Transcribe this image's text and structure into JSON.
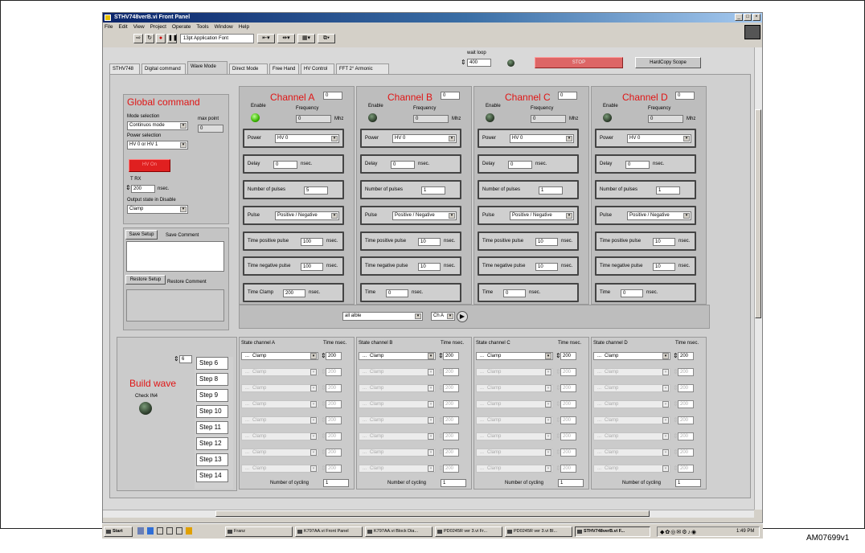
{
  "window": {
    "title": "STHV748verB.vi Front Panel"
  },
  "menu": [
    "File",
    "Edit",
    "View",
    "Project",
    "Operate",
    "Tools",
    "Window",
    "Help"
  ],
  "toolbar": {
    "font": "13pt Application Font"
  },
  "wait_loop": {
    "label": "wait loop",
    "value": "400"
  },
  "buttons": {
    "stop": "STOP",
    "hardcopy": "HardCopy Scope",
    "save_setup": "Save Setup",
    "restore_setup": "Restore Setup",
    "hv_on": "HV On"
  },
  "tabs": [
    "STHV748",
    "Digital command",
    "Wave Mode",
    "Direct Mode",
    "Free Hand",
    "HV Control",
    "FFT 2° Armonic"
  ],
  "global": {
    "title": "Global command",
    "mode_label": "Mode selection",
    "mode_value": "Continuos mode",
    "max_point_label": "max point",
    "max_point_value": "0",
    "power_label": "Power selection",
    "power_value": "HV 0 or HV 1",
    "trx_label": "T RX",
    "trx_value": "200",
    "nsec": "nsec.",
    "out_label": "Output state in Disable",
    "out_value": "Clamp",
    "save_comment": "Save Comment",
    "restore_comment": "Restore Comment"
  },
  "channels": [
    {
      "title": "Channel A",
      "id": "0",
      "enable_label": "Enable",
      "freq_label": "Frequency",
      "freq_value": "0",
      "freq_unit": "Mhz",
      "power_label": "Power",
      "power": "HV 0",
      "delay_label": "Delay",
      "delay": "0",
      "pulses_label": "Number of pulses",
      "pulses": "5",
      "pulse_label": "Pulse",
      "pulse": "Positive / Negative",
      "tpos_label": "Time positive pulse",
      "tpos": "100",
      "tneg_label": "Time negative pulse",
      "tneg": "100",
      "time_label": "Time Clamp",
      "time": "200",
      "unit": "nsec.",
      "led": "on",
      "state_label": "State channel A",
      "time_nsec_label": "Time nsec.",
      "cycling_label": "Number of cycling",
      "cycling": "1"
    },
    {
      "title": "Channel B",
      "id": "0",
      "enable_label": "Enable",
      "freq_label": "Frequency",
      "freq_value": "0",
      "freq_unit": "Mhz",
      "power_label": "Power",
      "power": "HV 0",
      "delay_label": "Delay",
      "delay": "0",
      "pulses_label": "Number of pulses",
      "pulses": "1",
      "pulse_label": "Pulse",
      "pulse": "Positive / Negative",
      "tpos_label": "Time positive pulse",
      "tpos": "10",
      "tneg_label": "Time negative pulse",
      "tneg": "10",
      "time_label": "Time",
      "time": "0",
      "unit": "nsec.",
      "led": "off",
      "state_label": "State channel B",
      "time_nsec_label": "Time nsec.",
      "cycling_label": "Number of cycling",
      "cycling": "1"
    },
    {
      "title": "Channel C",
      "id": "0",
      "enable_label": "Enable",
      "freq_label": "Frequency",
      "freq_value": "0",
      "freq_unit": "Mhz",
      "power_label": "Power",
      "power": "HV 0",
      "delay_label": "Delay",
      "delay": "0",
      "pulses_label": "Number of pulses",
      "pulses": "1",
      "pulse_label": "Pulse",
      "pulse": "Positive / Negative",
      "tpos_label": "Time positive pulse",
      "tpos": "10",
      "tneg_label": "Time negative pulse",
      "tneg": "10",
      "time_label": "Time",
      "time": "0",
      "unit": "nsec.",
      "led": "off",
      "state_label": "State channel C",
      "time_nsec_label": "Time nsec.",
      "cycling_label": "Number of cycling",
      "cycling": "1"
    },
    {
      "title": "Channel D",
      "id": "0",
      "enable_label": "Enable",
      "freq_label": "Frequency",
      "freq_value": "0",
      "freq_unit": "Mhz",
      "power_label": "Power",
      "power": "HV 0",
      "delay_label": "Delay",
      "delay": "0",
      "pulses_label": "Number of pulses",
      "pulses": "1",
      "pulse_label": "Pulse",
      "pulse": "Positive / Negative",
      "tpos_label": "Time positive pulse",
      "tpos": "10",
      "tneg_label": "Time negative pulse",
      "tneg": "10",
      "time_label": "Time",
      "time": "0",
      "unit": "nsec.",
      "led": "off",
      "state_label": "State channel D",
      "time_nsec_label": "Time nsec.",
      "cycling_label": "Number of cycling",
      "cycling": "1"
    }
  ],
  "middle": {
    "select": "all alble",
    "ch": "Ch A"
  },
  "build": {
    "title": "Build wave",
    "counter": "6",
    "check_label": "Check IN4",
    "steps": [
      "Step 6",
      "Step 8",
      "Step 9",
      "Step 10",
      "Step 11",
      "Step 12",
      "Step 13",
      "Step 14"
    ]
  },
  "state_rows": {
    "value": "Clamp",
    "prefix": "...",
    "time": "200"
  },
  "taskbar": {
    "start": "Start",
    "tasks": [
      "Franz",
      "K797AA.vi Front Panel",
      "K797AA.vi Block Dia...",
      "PD0245R ver 3.vi Fr...",
      "PD0245R ver 3.vi Bl...",
      "STHV748verB.vi F..."
    ],
    "clock": "1:49 PM"
  },
  "figure_id": "AM07699v1"
}
